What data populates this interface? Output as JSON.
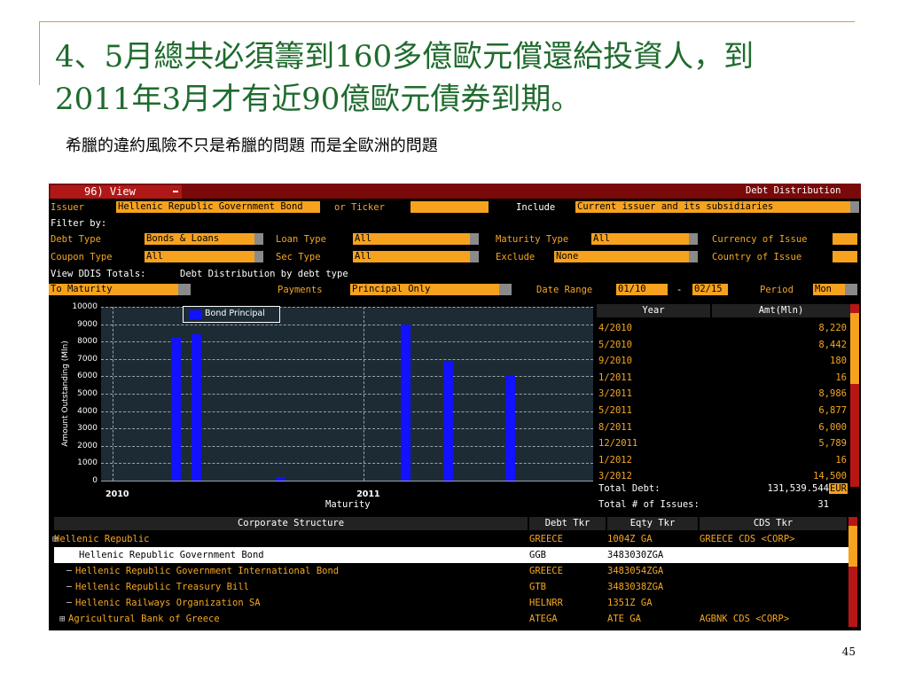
{
  "slide": {
    "title_line1": "4、5月總共必須籌到160多億歐元償還給投資人，到",
    "title_line2": "2011年3月才有近90億歐元債券到期。",
    "subtitle": "希臘的違約風險不只是希臘的問題 而是全歐洲的問題",
    "page_number": "45"
  },
  "terminal": {
    "view_tab": "96) View",
    "screen_title": "Debt Distribution",
    "issuer_label": "Issuer",
    "issuer_value": "Hellenic Republic Government Bond",
    "or_ticker_label": "or Ticker",
    "include_label": "Include",
    "include_value": "Current issuer and its subsidiaries",
    "filter_by_label": "Filter by:",
    "debt_type_label": "Debt Type",
    "debt_type_value": "Bonds & Loans",
    "loan_type_label": "Loan Type",
    "loan_type_value": "All",
    "maturity_type_label": "Maturity Type",
    "maturity_type_value": "All",
    "currency_label": "Currency of Issue",
    "coupon_type_label": "Coupon Type",
    "coupon_type_value": "All",
    "sec_type_label": "Sec Type",
    "sec_type_value": "All",
    "exclude_label": "Exclude",
    "exclude_value": "None",
    "country_label": "Country of Issue",
    "view_totals_label": "View DDIS Totals:",
    "view_totals_value": "Debt Distribution by debt type",
    "to_maturity_value": "To Maturity",
    "payments_label": "Payments",
    "payments_value": "Principal Only",
    "date_range_label": "Date Range",
    "date_from": "01/10",
    "date_sep": "-",
    "date_to": "02/15",
    "period_label": "Period",
    "period_value": "Mon"
  },
  "chart_data": {
    "type": "bar",
    "xlabel": "Maturity",
    "ylabel": "Amount Outstanding (Mln)",
    "ylim": [
      0,
      10000
    ],
    "yticks": [
      0,
      1000,
      2000,
      3000,
      4000,
      5000,
      6000,
      7000,
      8000,
      9000,
      10000
    ],
    "xtick_labels": [
      "2010",
      "2011"
    ],
    "legend": "Bond Principal",
    "grid": true,
    "series": [
      {
        "name": "Bond Principal",
        "points": [
          {
            "x": "4/2010",
            "y": 8220
          },
          {
            "x": "5/2010",
            "y": 8442
          },
          {
            "x": "9/2010",
            "y": 180
          },
          {
            "x": "1/2011",
            "y": 16
          },
          {
            "x": "3/2011",
            "y": 8986
          },
          {
            "x": "5/2011",
            "y": 6877
          },
          {
            "x": "8/2011",
            "y": 6000
          }
        ]
      }
    ]
  },
  "maturity_table": {
    "headers": [
      "Year",
      "Amt(Mln)"
    ],
    "rows": [
      [
        "4/2010",
        "8,220"
      ],
      [
        "5/2010",
        "8,442"
      ],
      [
        "9/2010",
        "180"
      ],
      [
        "1/2011",
        "16"
      ],
      [
        "3/2011",
        "8,986"
      ],
      [
        "5/2011",
        "6,877"
      ],
      [
        "8/2011",
        "6,000"
      ],
      [
        "12/2011",
        "5,789"
      ],
      [
        "1/2012",
        "16"
      ],
      [
        "3/2012",
        "14,500"
      ]
    ],
    "total_debt_label": "Total Debt:",
    "total_debt_value": "131,539.544",
    "currency": "EUR",
    "total_issues_label": "Total # of Issues:",
    "total_issues_value": "31"
  },
  "corporate": {
    "headers": [
      "Corporate Structure",
      "Debt Tkr",
      "Eqty Tkr",
      "CDS Tkr"
    ],
    "rows": [
      {
        "name": "Hellenic Republic",
        "debt": "GREECE",
        "eqty": "1004Z GA",
        "cds": "GREECE CDS <CORP>"
      },
      {
        "name": "Hellenic Republic Government Bond",
        "debt": "GGB",
        "eqty": "3483030ZGA",
        "cds": ""
      },
      {
        "name": "Hellenic Republic Government International Bond",
        "debt": "GREECE",
        "eqty": "3483054ZGA",
        "cds": ""
      },
      {
        "name": "Hellenic Republic Treasury Bill",
        "debt": "GTB",
        "eqty": "3483038ZGA",
        "cds": ""
      },
      {
        "name": "Hellenic Railways Organization SA",
        "debt": "HELNRR",
        "eqty": "1351Z GA",
        "cds": ""
      },
      {
        "name": "Agricultural Bank of Greece",
        "debt": "ATEGA",
        "eqty": "ATE GA",
        "cds": "AGBNK CDS <CORP>"
      }
    ]
  },
  "colors": {
    "accent_orange": "#f7a21e",
    "bar_blue": "#1212ff",
    "title_green": "#1f6b2e",
    "tab_red": "#b01818"
  }
}
